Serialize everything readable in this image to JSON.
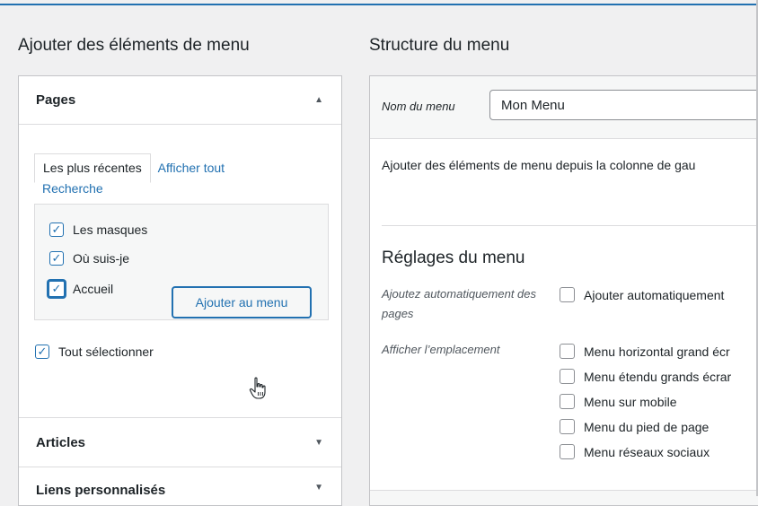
{
  "left": {
    "heading": "Ajouter des éléments de menu",
    "pages": {
      "title": "Pages",
      "arrow": "▲",
      "tabs": {
        "recent": "Les plus récentes",
        "all": "Afficher tout",
        "search": "Recherche"
      },
      "items": [
        {
          "label": "Les masques",
          "checked": true
        },
        {
          "label": "Où suis-je",
          "checked": true
        },
        {
          "label": "Accueil",
          "checked": true
        }
      ],
      "select_all": "Tout sélectionner",
      "add_button": "Ajouter au menu"
    },
    "articles": {
      "title": "Articles",
      "arrow": "▼"
    },
    "custom_links": {
      "title": "Liens personnalisés",
      "arrow": "▼"
    }
  },
  "right": {
    "heading": "Structure du menu",
    "menu_name_label": "Nom du menu",
    "menu_name_value": "Mon Menu",
    "instructions": "Ajouter des éléments de menu depuis la colonne de gau",
    "settings_title": "Réglages du menu",
    "auto_add_label": "Ajoutez automatiquement des pages",
    "auto_add_option": "Ajouter automatiquement",
    "location_label": "Afficher l’emplacement",
    "locations": [
      "Menu horizontal grand écr",
      "Menu étendu grands écrar",
      "Menu sur mobile",
      "Menu du pied de page",
      "Menu réseaux sociaux"
    ]
  },
  "colors": {
    "accent": "#2271b1",
    "border": "#c3c4c7",
    "background": "#f0f0f1"
  }
}
